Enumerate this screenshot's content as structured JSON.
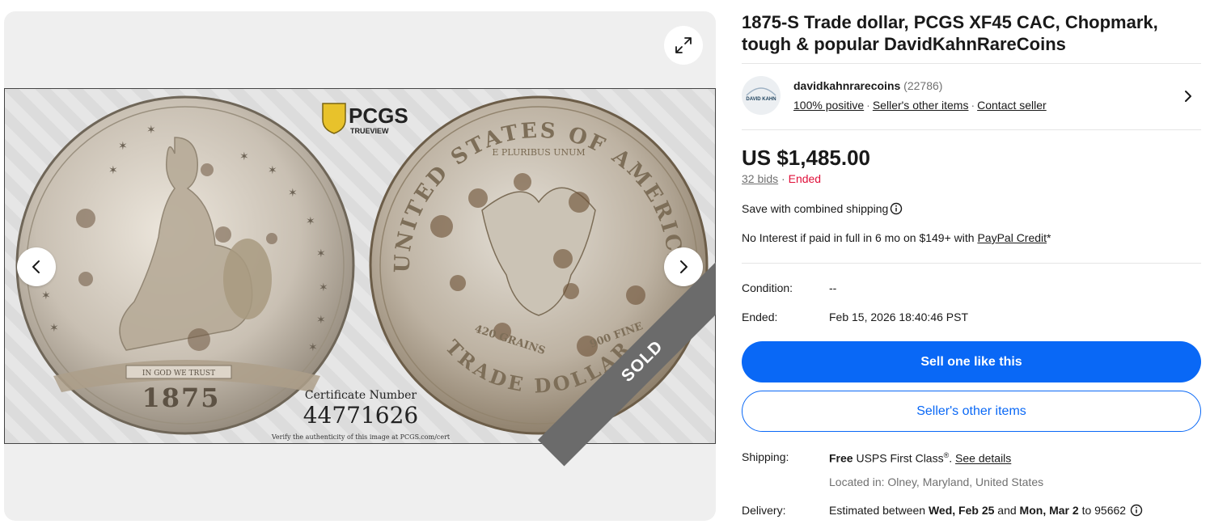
{
  "colors": {
    "accent": "#0968f6",
    "ended": "#e0103a",
    "muted": "#707070",
    "sold_ribbon": "#6b6b6b"
  },
  "gallery": {
    "expand_icon": "expand-icon",
    "prev_icon": "chevron-left-icon",
    "next_icon": "chevron-right-icon",
    "sold_label": "SOLD",
    "photo": {
      "brand_logo_text": "PCGS",
      "brand_sub": "TRUEVIEW",
      "obverse_motto": "IN GOD WE TRUST",
      "obverse_date": "1875",
      "reverse_top": "UNITED STATES OF AMERICA",
      "reverse_motto": "E PLURIBUS UNUM",
      "reverse_weight": "420 GRAINS",
      "reverse_fine": "900 FINE",
      "reverse_bottom": "TRADE DOLLAR",
      "cert_label": "Certificate Number",
      "cert_number": "44771626",
      "verify_text": "Verify the authenticity of this image at PCGS.com/cert"
    }
  },
  "listing": {
    "title": "1875-S Trade dollar, PCGS XF45 CAC, Chopmark, tough & popular DavidKahnRareCoins"
  },
  "seller": {
    "avatar_text": "DAVID KAHN",
    "name": "davidkahnrarecoins",
    "feedback_count": "(22786)",
    "positive": "100% positive",
    "other_items": "Seller's other items",
    "contact": "Contact seller"
  },
  "price": {
    "amount": "US $1,485.00",
    "bids": "32 bids",
    "status": "Ended"
  },
  "promo": {
    "combined_shipping": "Save with combined shipping",
    "no_interest_prefix": "No Interest if paid in full in 6 mo on $149+ with ",
    "no_interest_link": "PayPal Credit",
    "no_interest_suffix": "*"
  },
  "details": {
    "condition_label": "Condition:",
    "condition_value": "--",
    "ended_label": "Ended:",
    "ended_value": "Feb 15, 2026 18:40:46 PST"
  },
  "actions": {
    "sell_one": "Sell one like this",
    "other_items": "Seller's other items"
  },
  "shipping": {
    "label": "Shipping:",
    "free": "Free",
    "method": " USPS First Class",
    "reg": "®",
    "period": ".",
    "details_link": "See details",
    "location": "Located in: Olney, Maryland, United States"
  },
  "delivery": {
    "label": "Delivery:",
    "prefix": "Estimated between ",
    "start": "Wed, Feb 25",
    "and": " and ",
    "end": "Mon, Mar 2",
    "to": " to 95662"
  }
}
